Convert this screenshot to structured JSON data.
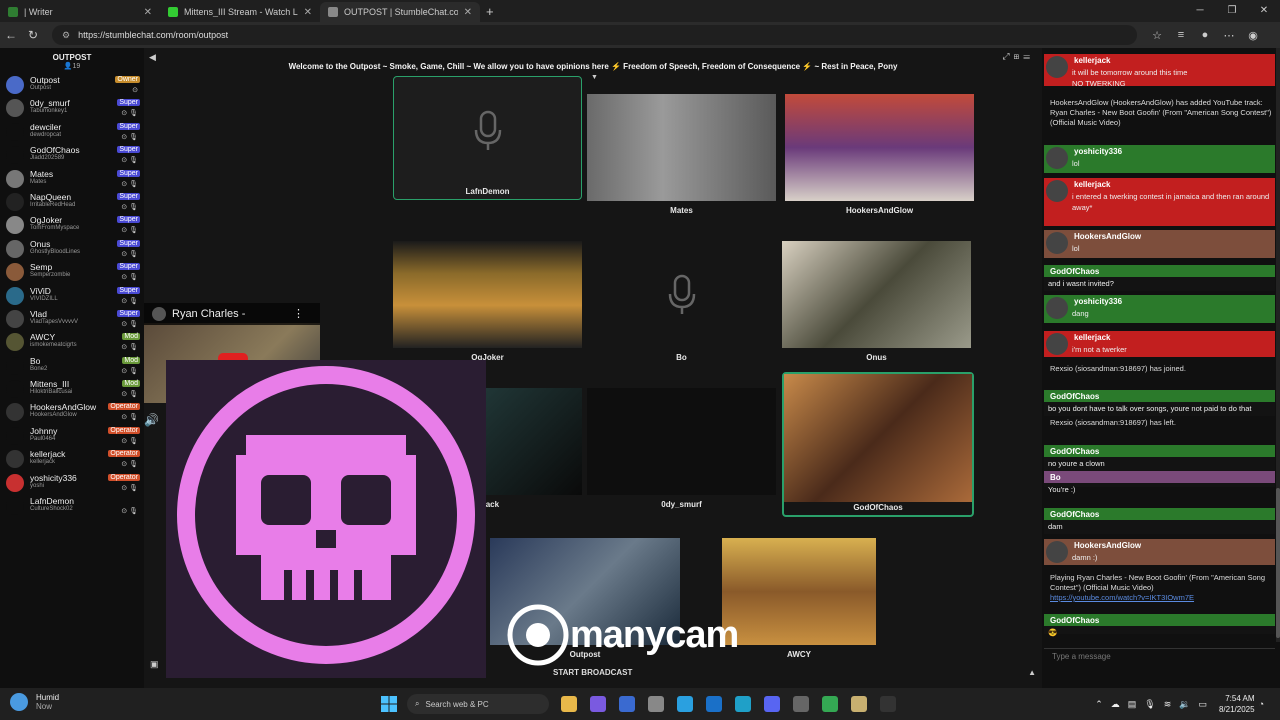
{
  "browser": {
    "tabs": [
      {
        "title": "| Writer",
        "color": "#2f7d32"
      },
      {
        "title": "Mittens_III Stream - Watch Live o",
        "color": "#33cc33"
      },
      {
        "title": "OUTPOST | StumbleChat.com",
        "color": "#888888"
      }
    ],
    "url": "https://stumblechat.com/room/outpost"
  },
  "room": {
    "name": "OUTPOST",
    "count": "19",
    "topic": "Welcome to the Outpost ~ Smoke, Game, Chill ~ We allow you to have opinions here ⚡ Freedom of Speech, Freedom of Consequence ⚡ ~ Rest in Peace, Pony"
  },
  "users": [
    {
      "name": "Outpost",
      "sub": "Outpost",
      "role": "Owner",
      "rcls": "owner",
      "av": "#4a6ac8"
    },
    {
      "name": "0dy_smurf",
      "sub": "Tabumonkey1",
      "role": "Super",
      "rcls": "super",
      "av": "#555"
    },
    {
      "name": "dewciler",
      "sub": "dewdropcat",
      "role": "Super",
      "rcls": "super",
      "av": "#0f0f0f"
    },
    {
      "name": "GodOfChaos",
      "sub": "Jladd202589",
      "role": "Super",
      "rcls": "super",
      "av": "#0f0f0f"
    },
    {
      "name": "Mates",
      "sub": "Mates",
      "role": "Super",
      "rcls": "super",
      "av": "#777"
    },
    {
      "name": "NapQueen",
      "sub": "IrritableRedHead",
      "role": "Super",
      "rcls": "super",
      "av": "#222"
    },
    {
      "name": "OgJoker",
      "sub": "TomFromMyspace",
      "role": "Super",
      "rcls": "super",
      "av": "#888"
    },
    {
      "name": "Onus",
      "sub": "GhostlyBloodLines",
      "role": "Super",
      "rcls": "super",
      "av": "#666"
    },
    {
      "name": "Semp",
      "sub": "Semperzombie",
      "role": "Super",
      "rcls": "super",
      "av": "#8a5a3a"
    },
    {
      "name": "ViViD",
      "sub": "VIVIDZILL",
      "role": "Super",
      "rcls": "super",
      "av": "#2a6a8a"
    },
    {
      "name": "Vlad",
      "sub": "VladTapesVvvvvV",
      "role": "Super",
      "rcls": "super",
      "av": "#444"
    },
    {
      "name": "AWCY",
      "sub": "ismokemeatcigrts",
      "role": "Mod",
      "rcls": "mod",
      "av": "#553"
    },
    {
      "name": "Bo",
      "sub": "Bone2",
      "role": "Mod",
      "rcls": "mod",
      "av": "#0f0f0f"
    },
    {
      "name": "Mittens_III",
      "sub": "HiloktriBallcusai",
      "role": "Mod",
      "rcls": "mod",
      "av": "#0f0f0f"
    },
    {
      "name": "HookersAndGlow",
      "sub": "HookersAndGlow",
      "role": "Operator",
      "rcls": "op",
      "av": "#333"
    },
    {
      "name": "Johnny",
      "sub": "Paul0464",
      "role": "Operator",
      "rcls": "op",
      "av": "#0f0f0f"
    },
    {
      "name": "kellerjack",
      "sub": "kellerjack",
      "role": "Operator",
      "rcls": "op",
      "av": "#333"
    },
    {
      "name": "yoshicity336",
      "sub": "yoshi",
      "role": "Operator",
      "rcls": "op",
      "av": "#c83030"
    },
    {
      "name": "LafnDemon",
      "sub": "CultureShock02",
      "role": "",
      "rcls": "",
      "av": "#0f0f0f"
    }
  ],
  "videos": [
    {
      "name": "LafnDemon",
      "kind": "mic"
    },
    {
      "name": "Mates",
      "kind": "cam"
    },
    {
      "name": "HookersAndGlow",
      "kind": "cam"
    },
    {
      "name": "OgJoker",
      "kind": "cam"
    },
    {
      "name": "Bo",
      "kind": "mic"
    },
    {
      "name": "Onus",
      "kind": "cam"
    },
    {
      "name": "erjack",
      "kind": "cam"
    },
    {
      "name": "0dy_smurf",
      "kind": "blank"
    },
    {
      "name": "GodOfChaos",
      "kind": "cam"
    },
    {
      "name": "Outpost",
      "kind": "cam"
    },
    {
      "name": "AWCY",
      "kind": "cam"
    }
  ],
  "youtube": {
    "title": "Ryan Charles -"
  },
  "overlay": {
    "brand": "manycam",
    "broadcast": "START BROADCAST"
  },
  "chat": {
    "placeholder": "Type a message",
    "messages": [
      {
        "name": "kellerjack",
        "bg": "#c21f1f",
        "lines": [
          "it will be tomorrow around this time",
          "NO TWERKING"
        ]
      },
      {
        "sys": true,
        "lines": [
          "HookersAndGlow (HookersAndGlow) has added YouTube track:",
          "Ryan Charles - New Boot Goofin' (From \"American Song Contest\") (Official Music Video)"
        ]
      },
      {
        "name": "yoshicity336",
        "bg": "#2b7a2b",
        "lines": [
          "lol"
        ]
      },
      {
        "name": "kellerjack",
        "bg": "#c21f1f",
        "lines": [
          "i entered a twerking contest in jamaica and then ran around",
          "away*"
        ]
      },
      {
        "name": "HookersAndGlow",
        "bg": "#7d4e3c",
        "lines": [
          "lol"
        ]
      },
      {
        "name": "GodOfChaos",
        "bg": "#2b7a2b",
        "lines": [
          "and i wasnt invited?"
        ]
      },
      {
        "name": "yoshicity336",
        "bg": "#2b7a2b",
        "lines": [
          "dang"
        ]
      },
      {
        "name": "kellerjack",
        "bg": "#c21f1f",
        "lines": [
          "i'm not a twerker"
        ]
      },
      {
        "sys": true,
        "lines": [
          "Rexsio (siosandman:918697) has joined."
        ]
      },
      {
        "name": "GodOfChaos",
        "bg": "#2b7a2b",
        "lines": [
          "bo you dont have to talk over songs, youre not paid to do that"
        ]
      },
      {
        "sys": true,
        "lines": [
          "Rexsio (siosandman:918697) has left."
        ]
      },
      {
        "name": "GodOfChaos",
        "bg": "#2b7a2b",
        "lines": [
          "no youre a clown"
        ]
      },
      {
        "name": "Bo",
        "bg": "#7a4a7a",
        "lines": [
          "You're :)"
        ]
      },
      {
        "name": "GodOfChaos",
        "bg": "#2b7a2b",
        "lines": [
          "dam"
        ]
      },
      {
        "name": "HookersAndGlow",
        "bg": "#7d4e3c",
        "lines": [
          "damn :)"
        ]
      },
      {
        "sys": true,
        "lines": [
          "Playing Ryan Charles - New Boot Goofin' (From \"American Song Contest\") (Official Music Video)",
          "https://youtube.com/watch?v=IKT3IOwm7E"
        ]
      },
      {
        "name": "GodOfChaos",
        "bg": "#2b7a2b",
        "lines": [
          "😎"
        ]
      }
    ]
  },
  "taskbar": {
    "weather_title": "Humid",
    "weather_sub": "Now",
    "search_placeholder": "Search web & PC",
    "time": "7:54 AM",
    "date": "8/21/2025"
  }
}
